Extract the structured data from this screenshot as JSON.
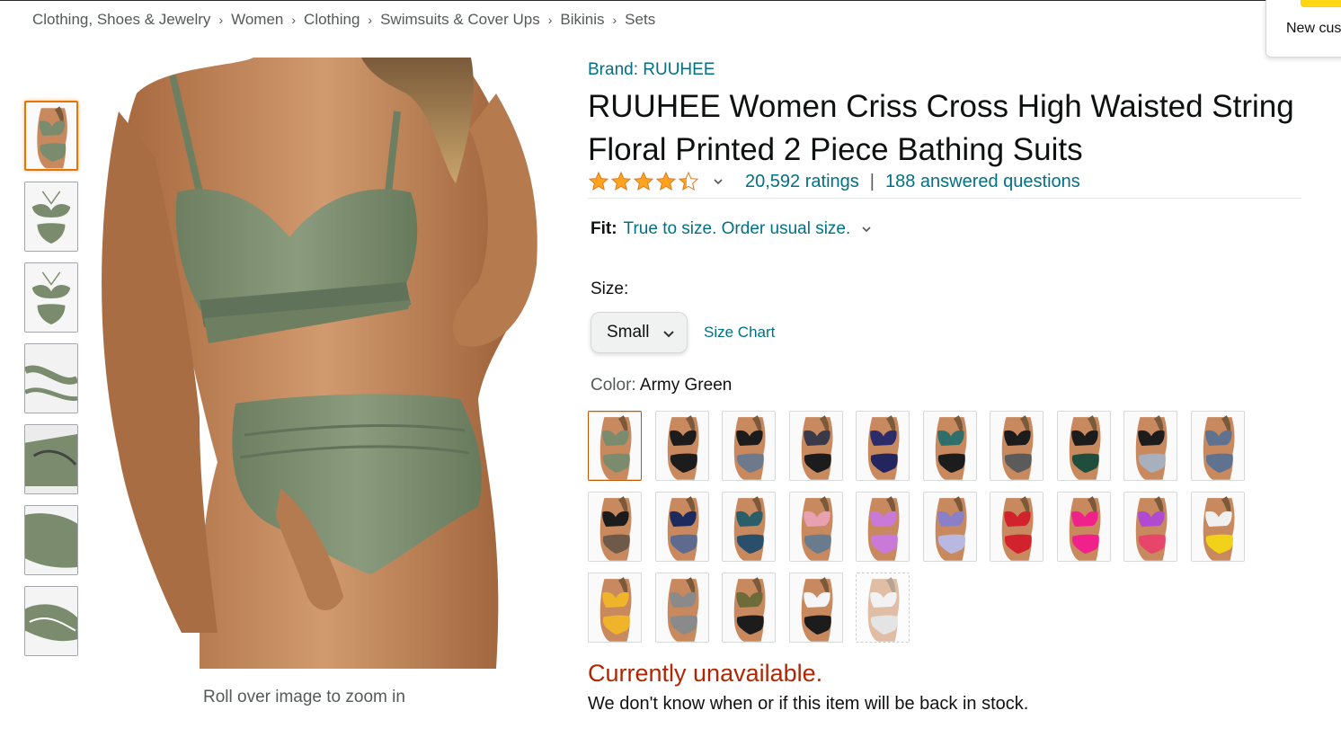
{
  "breadcrumb": [
    {
      "label": "Clothing, Shoes & Jewelry"
    },
    {
      "label": "Women"
    },
    {
      "label": "Clothing"
    },
    {
      "label": "Swimsuits & Cover Ups"
    },
    {
      "label": "Bikinis"
    },
    {
      "label": "Sets"
    }
  ],
  "breadcrumb_separator": "›",
  "popover": {
    "text": "New cus",
    "button_color": "#ffd814"
  },
  "thumbnails": [
    {
      "icon": "bikini-model-photo",
      "selected": true
    },
    {
      "icon": "bikini-flatlay-photo",
      "selected": false
    },
    {
      "icon": "bikini-flatlay-photo",
      "selected": false
    },
    {
      "icon": "strap-detail-photo",
      "selected": false
    },
    {
      "icon": "cup-detail-photo",
      "selected": false
    },
    {
      "icon": "fabric-detail-photo",
      "selected": false
    },
    {
      "icon": "bottom-detail-photo",
      "selected": false
    }
  ],
  "main_image": {
    "icon": "bikini-model-photo",
    "zoom_hint": "Roll over image to zoom in"
  },
  "product": {
    "brand": "Brand: RUUHEE",
    "title": "RUUHEE Women Criss Cross High Waisted String Floral Printed 2 Piece Bathing Suits",
    "rating": 4.4,
    "rating_max": 5,
    "ratings_count": "20,592 ratings",
    "answered_questions": "188 answered questions",
    "rating_separator": "|",
    "fit": {
      "label": "Fit:",
      "value": "True to size. Order usual size."
    },
    "size": {
      "label": "Size:",
      "selected": "Small",
      "size_chart": "Size Chart"
    },
    "color": {
      "label": "Color: ",
      "selected": "Army Green"
    },
    "availability": {
      "status": "Currently unavailable.",
      "note": "We don't know when or if this item will be back in stock."
    }
  },
  "swatches": [
    {
      "top": "#7a8b6e",
      "bottom": "#7a8b6e",
      "selected": true,
      "available": true
    },
    {
      "top": "#1c1c1c",
      "bottom": "#1c1c1c",
      "selected": false,
      "available": true
    },
    {
      "top": "#1c1c1c",
      "bottom": "#6d7a8c",
      "selected": false,
      "available": true
    },
    {
      "top": "#3a3a4a",
      "bottom": "#1c1c1c",
      "selected": false,
      "available": true
    },
    {
      "top": "#2c2c6a",
      "bottom": "#24245e",
      "selected": false,
      "available": true
    },
    {
      "top": "#2f6f6b",
      "bottom": "#1c1c1c",
      "selected": false,
      "available": true
    },
    {
      "top": "#1c1c1c",
      "bottom": "#5b5b5b",
      "selected": false,
      "available": true
    },
    {
      "top": "#1c1c1c",
      "bottom": "#1f4f3c",
      "selected": false,
      "available": true
    },
    {
      "top": "#1c1c1c",
      "bottom": "#a7b0bc",
      "selected": false,
      "available": true
    },
    {
      "top": "#5f7391",
      "bottom": "#5f7391",
      "selected": false,
      "available": true
    },
    {
      "top": "#1c1c1c",
      "bottom": "#6f5a4a",
      "selected": false,
      "available": true
    },
    {
      "top": "#1d2a5e",
      "bottom": "#5e6a8e",
      "selected": false,
      "available": true
    },
    {
      "top": "#2a5f6a",
      "bottom": "#2a4f6a",
      "selected": false,
      "available": true
    },
    {
      "top": "#e7a1b0",
      "bottom": "#6a7b8e",
      "selected": false,
      "available": true
    },
    {
      "top": "#c97ad8",
      "bottom": "#c97ad8",
      "selected": false,
      "available": true
    },
    {
      "top": "#8a80c8",
      "bottom": "#b8b8e0",
      "selected": false,
      "available": true
    },
    {
      "top": "#d2222d",
      "bottom": "#d2222d",
      "selected": false,
      "available": true
    },
    {
      "top": "#f0218b",
      "bottom": "#f0218b",
      "selected": false,
      "available": true
    },
    {
      "top": "#b04ad0",
      "bottom": "#e8456b",
      "selected": false,
      "available": true
    },
    {
      "top": "#f0f0f0",
      "bottom": "#f2d11b",
      "selected": false,
      "available": true
    },
    {
      "top": "#f0b42a",
      "bottom": "#f0b42a",
      "selected": false,
      "available": true
    },
    {
      "top": "#8a8a8a",
      "bottom": "#8a8a8a",
      "selected": false,
      "available": true
    },
    {
      "top": "#6e6b3a",
      "bottom": "#1c1c1c",
      "selected": false,
      "available": true
    },
    {
      "top": "#f5f5f5",
      "bottom": "#1c1c1c",
      "selected": false,
      "available": true
    },
    {
      "top": "#e8e8e8",
      "bottom": "#cfcfcf",
      "selected": false,
      "available": false
    }
  ],
  "colors": {
    "link": "#007185",
    "price_red": "#b12704",
    "star": "#ffa41c",
    "selected_border": "#e77600",
    "skin": "#c8895f",
    "product_green": "#7a8b6e"
  }
}
